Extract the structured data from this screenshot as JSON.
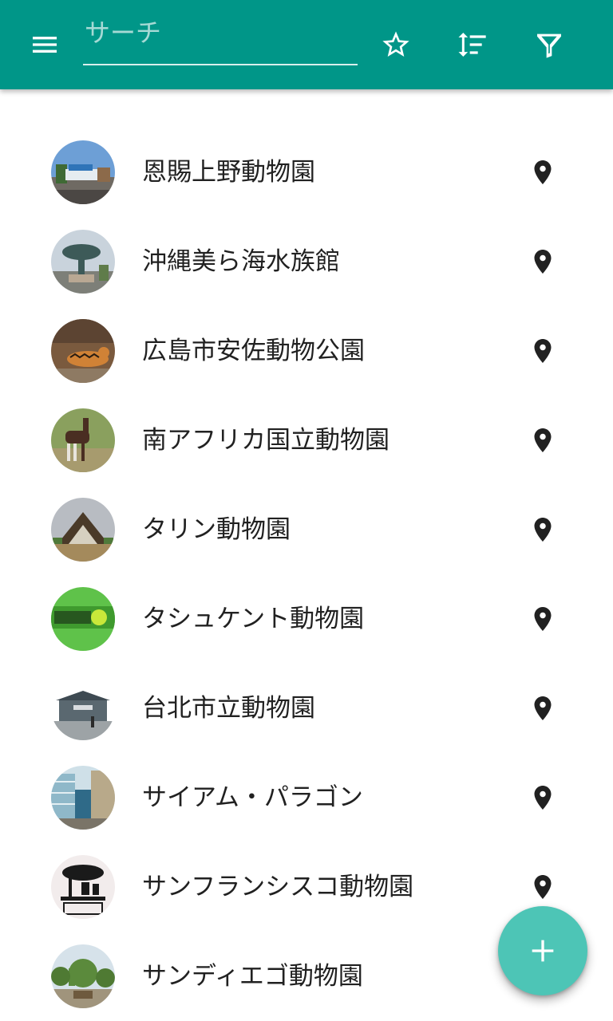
{
  "toolbar": {
    "background": "#009688",
    "search": {
      "placeholder": "サーチ",
      "value": ""
    },
    "icons": [
      "menu-icon",
      "star-outline-icon",
      "sort-icon",
      "filter-icon"
    ]
  },
  "list": {
    "items": [
      {
        "label": "恩賜上野動物園",
        "thumb": "zoo-gate-photo"
      },
      {
        "label": "沖縄美ら海水族館",
        "thumb": "whale-shark-statue-photo"
      },
      {
        "label": "広島市安佐動物公園",
        "thumb": "tiger-photo"
      },
      {
        "label": "南アフリカ国立動物園",
        "thumb": "okapi-photo"
      },
      {
        "label": "タリン動物園",
        "thumb": "triangular-gate-photo"
      },
      {
        "label": "タシュケント動物園",
        "thumb": "green-sign-photo"
      },
      {
        "label": "台北市立動物園",
        "thumb": "zoo-building-photo"
      },
      {
        "label": "サイアム・パラゴン",
        "thumb": "mall-atrium-photo"
      },
      {
        "label": "サンフランシスコ動物園",
        "thumb": "sf-zoo-logo"
      },
      {
        "label": "サンディエゴ動物園",
        "thumb": "topiary-elephant-photo"
      }
    ],
    "pin_icon": "location-pin-icon"
  },
  "fab": {
    "icon": "plus-icon",
    "color": "#4DC5B6"
  }
}
